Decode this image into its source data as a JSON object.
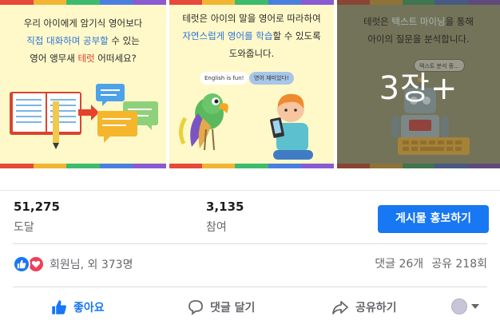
{
  "collage": {
    "panel1": {
      "line1": "우리 아이에게 암기식 영어보다",
      "line2_blue": "직접 대화하며 공부할",
      "line2_rest": " 수 있는",
      "line3_start": "영어 앵무새 ",
      "line3_red": "테럿",
      "line3_end": " 어떠세요?"
    },
    "panel2": {
      "line1": "테럿은 아이의 말을 영어로 따라하여",
      "line2_blue": "자연스럽게 영어를 학습",
      "line2_rest": "할 수 있도록",
      "line3": "도와줍니다.",
      "bubble_left": "English is fun!",
      "bubble_right": "영어 재미있다!"
    },
    "panel3": {
      "line1_start": "테럿은 ",
      "line1_blue": "텍스트 마이닝",
      "line1_end": "을 통해",
      "line2": "아이의 질문을 분석합니다.",
      "bubble": "텍스트 분석 중..."
    },
    "more_label": "3장+",
    "stripe_colors": [
      "#e6493a",
      "#f2b533",
      "#3dbb6d",
      "#4a7fe0",
      "#8a5ad2"
    ]
  },
  "stats": {
    "reach": {
      "value": "51,275",
      "label": "도달"
    },
    "engagement": {
      "value": "3,135",
      "label": "참여"
    },
    "promote_button": "게시물 홍보하기"
  },
  "reactions": {
    "text": "회원님, 외 373명",
    "comments": "댓글 26개",
    "shares": "공유 218회"
  },
  "actions": {
    "like": "좋아요",
    "comment": "댓글 달기",
    "share": "공유하기"
  },
  "colors": {
    "accent": "#1877f2",
    "love": "#f33e58",
    "muted_text": "#65676b"
  },
  "icons": {
    "like": "thumbs-up-icon",
    "love": "heart-icon",
    "comment": "speech-bubble-icon",
    "share": "share-arrow-icon",
    "audience": "globe-icon",
    "dropdown": "caret-down-icon"
  }
}
